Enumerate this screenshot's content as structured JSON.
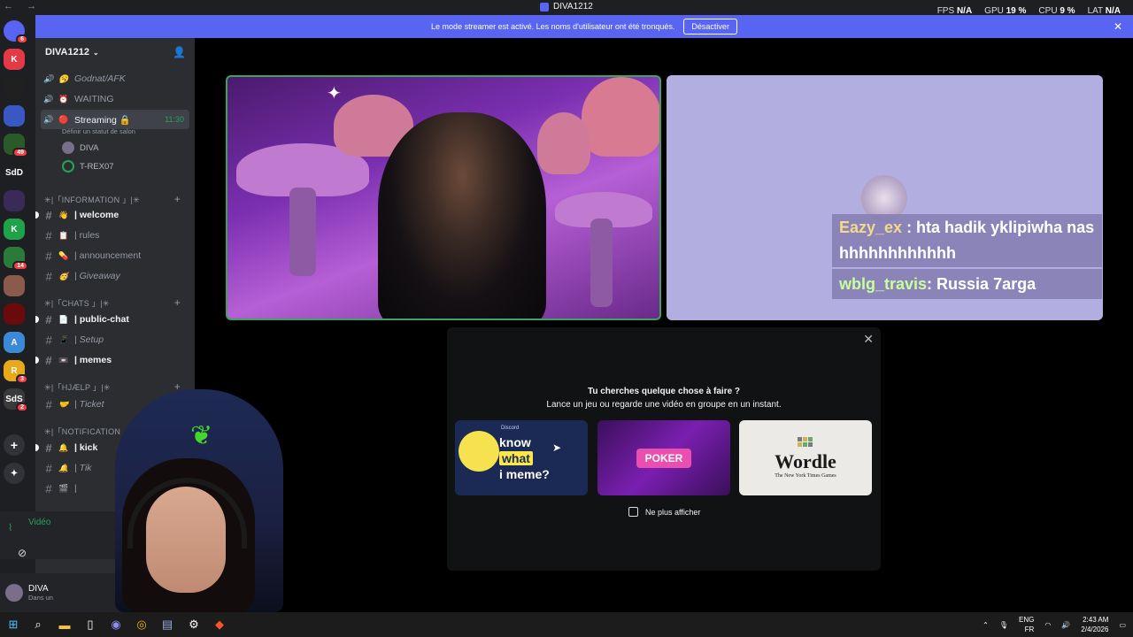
{
  "titlebar": {
    "title": "DIVA1212",
    "nav": "← →"
  },
  "stats": {
    "fps_label": "FPS",
    "fps": "N/A",
    "gpu_label": "GPU",
    "gpu": "19 %",
    "cpu_label": "CPU",
    "cpu": "9 %",
    "lat_label": "LAT",
    "lat": "N/A"
  },
  "banner": {
    "text": "Le mode streamer est activé. Les noms d'utilisateur ont été tronqués.",
    "button": "Désactiver",
    "close": "✕"
  },
  "rail": {
    "servers": [
      {
        "label": "",
        "color": "#5865f2",
        "badge": "6"
      },
      {
        "label": "K",
        "color": "#e63946",
        "badge": ""
      },
      {
        "label": "",
        "color": "#202020",
        "badge": ""
      },
      {
        "label": "",
        "color": "#3a58c4",
        "badge": ""
      },
      {
        "label": "",
        "color": "#2a5a2a",
        "badge": "49"
      },
      {
        "label": "SdD",
        "color": "#1e1f22",
        "badge": ""
      },
      {
        "label": "",
        "color": "#3a2a5a",
        "badge": ""
      },
      {
        "label": "K",
        "color": "#1fa34a",
        "badge": ""
      },
      {
        "label": "",
        "color": "#2a7a3a",
        "badge": "14"
      },
      {
        "label": "",
        "color": "#8a5a4a",
        "badge": ""
      },
      {
        "label": "",
        "color": "#6a0a0a",
        "badge": ""
      },
      {
        "label": "A",
        "color": "#3a8ad8",
        "badge": ""
      },
      {
        "label": "R",
        "color": "#e8a81a",
        "badge": "3"
      },
      {
        "label": "SdS",
        "color": "#3a3a3a",
        "badge": "2"
      }
    ],
    "add": "+",
    "discover": "✦"
  },
  "sidebar": {
    "server_name": "DIVA1212",
    "voice": [
      {
        "emoji": "🥱",
        "label": "Godnat/AFK",
        "style": "it"
      },
      {
        "emoji": "⏰",
        "label": "WAITING",
        "style": ""
      },
      {
        "emoji": "🔴",
        "label": "Streaming 🔒",
        "style": "sel",
        "time": "11:30"
      }
    ],
    "voice_status": "Définir un statut de salon",
    "voice_users": [
      "DIVA",
      "T-REX07"
    ],
    "cat_info": "✳|「INFORMATION 」|✳",
    "info_channels": [
      {
        "emoji": "👋",
        "label": "| welcome",
        "style": "bold"
      },
      {
        "emoji": "📋",
        "label": "| rules",
        "style": ""
      },
      {
        "emoji": "💊",
        "label": "| announcement",
        "style": ""
      },
      {
        "emoji": "🥳",
        "label": "| Giveaway",
        "style": "it"
      }
    ],
    "cat_chats": "✳|「CHATS 」|✳",
    "chat_channels": [
      {
        "emoji": "📄",
        "label": "| public-chat",
        "style": "bold"
      },
      {
        "emoji": "📱",
        "label": "| Setup",
        "style": "it"
      },
      {
        "emoji": "📼",
        "label": "| memes",
        "style": "bold"
      }
    ],
    "cat_help": "✳|「HJÆLP 」|✳",
    "help_channels": [
      {
        "emoji": "🤝",
        "label": "| Ticket",
        "style": "it"
      }
    ],
    "cat_notif": "✳|「NOTIFICATION",
    "notif_channels": [
      {
        "emoji": "🔔",
        "label": "| kick",
        "style": "bold"
      },
      {
        "emoji": "🔔",
        "label": "| Tik",
        "style": "it"
      },
      {
        "emoji": "🎬",
        "label": "|",
        "style": ""
      }
    ],
    "voice_connected": "Vidéo",
    "user_name": "DIVA",
    "user_status": "Dans un"
  },
  "stream": {
    "chat": [
      {
        "nick": "Eazy_ex",
        "text": " : hta hadik yklipiwha nas",
        "cont": "hhhhhhhhhhhh"
      },
      {
        "nick": "wblg_travis",
        "text": " : Russia 7arga"
      }
    ]
  },
  "popup": {
    "title": "Tu cherches quelque chose à faire ?",
    "subtitle": "Lance un jeu ou regarde une vidéo en groupe en un instant.",
    "close": "✕",
    "card1": {
      "w1": "know",
      "w2": "what",
      "w3": "i meme?",
      "brand": "Discord"
    },
    "card2": {
      "label": "POKER"
    },
    "card3": {
      "label": "Wordle",
      "sub": "The New York Times Games"
    },
    "checkbox": "Ne plus afficher"
  },
  "taskbar": {
    "lang1": "ENG",
    "lang2": "FR",
    "time": "2:43 AM",
    "date": "2/4/2026"
  },
  "colors": {
    "accent": "#5865f2",
    "green": "#23a55a",
    "rail": "#1e1f22",
    "sidebar": "#2b2d31"
  }
}
